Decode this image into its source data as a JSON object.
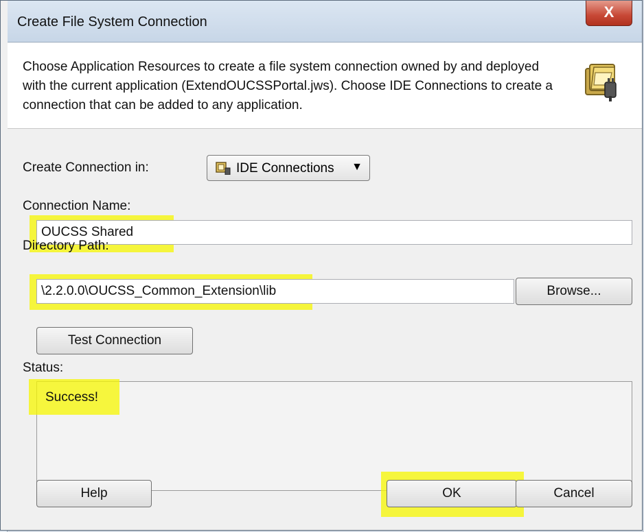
{
  "window": {
    "title": "Create File System Connection",
    "close_label": "X"
  },
  "header": {
    "description": "Choose Application Resources to create a file system connection owned by and deployed with the current application (ExtendOUCSSPortal.jws). Choose IDE Connections to create a connection that can be added to any application.",
    "icon": "folder-connection-icon"
  },
  "form": {
    "create_in_label": "Create Connection in:",
    "create_in_value": "IDE Connections",
    "connection_name_label": "Connection Name:",
    "connection_name_value": "OUCSS Shared",
    "directory_path_label": "Directory Path:",
    "directory_path_value": "\\2.2.0.0\\OUCSS_Common_Extension\\lib",
    "browse_label": "Browse...",
    "test_connection_label": "Test Connection",
    "status_label": "Status:",
    "status_value": "Success!"
  },
  "footer": {
    "help_label": "Help",
    "ok_label": "OK",
    "cancel_label": "Cancel"
  },
  "colors": {
    "highlight": "#f7f700"
  }
}
